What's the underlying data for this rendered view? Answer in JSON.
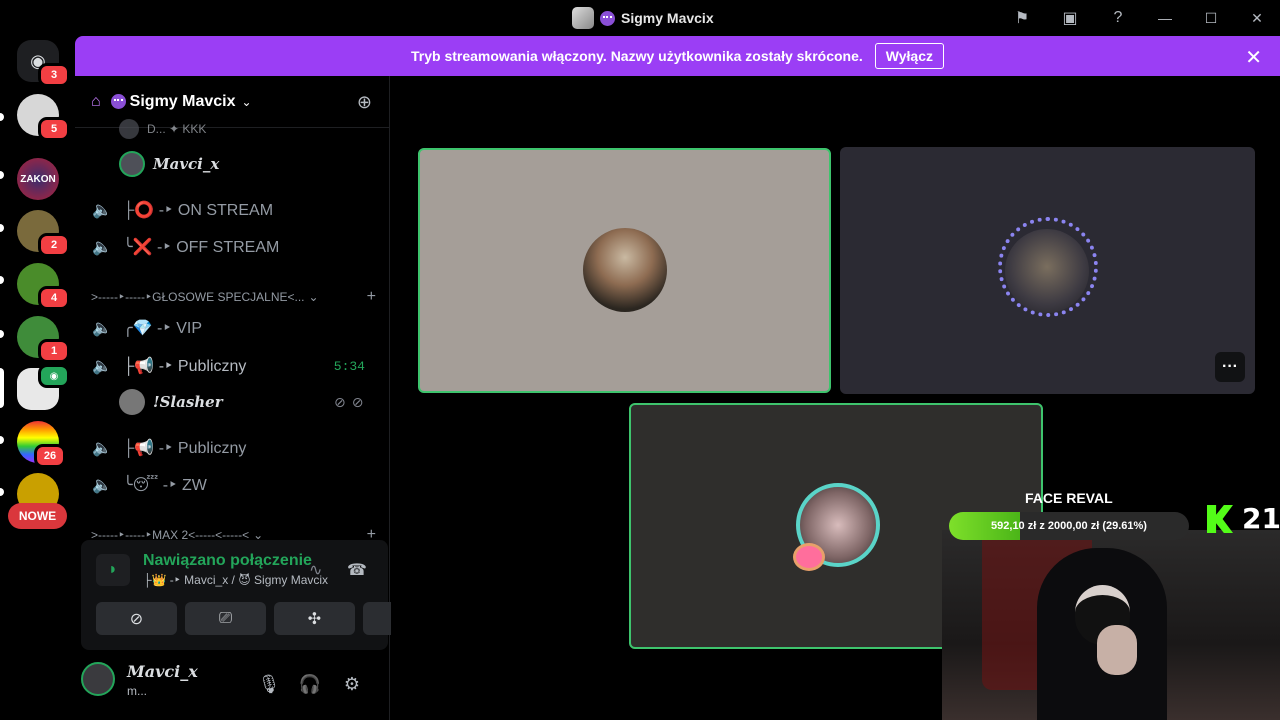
{
  "window": {
    "title": "Sigmy Mavcix",
    "controls": [
      "flag-icon",
      "inbox-icon",
      "help-icon",
      "minimize-icon",
      "maximize-icon",
      "close-icon"
    ]
  },
  "rail": {
    "home_badge": "3",
    "servers": [
      {
        "badge": "5"
      },
      {
        "label": "ZAKON"
      },
      {
        "badge": "2"
      },
      {
        "badge": "4"
      },
      {
        "badge": "1"
      },
      {
        "badge": ""
      },
      {
        "badge": "26"
      },
      {
        "badge": ""
      }
    ],
    "new_label": "NOWE"
  },
  "banner": {
    "text": "Tryb streamowania włączony. Nazwy użytkownika zostały skrócone.",
    "button": "Wyłącz"
  },
  "guild": {
    "name": "Sigmy Mavcix"
  },
  "channels": {
    "partial_top": "D... ✦ KKK",
    "member_top": "Mavci_x",
    "list1": [
      {
        "name": "├⭕ -‣ ON STREAM"
      },
      {
        "name": "╰❌ -‣ OFF STREAM"
      }
    ],
    "category1": ">-----‣-----‣GŁOSOWE SPECJALNE<...",
    "list2": [
      {
        "name": "╭💎 -‣ VIP"
      },
      {
        "name": "├📢 -‣ Publiczny",
        "time": "5:34"
      }
    ],
    "member_mid": "!Slasher",
    "list3": [
      {
        "name": "├📢 -‣ Publiczny"
      },
      {
        "name": "╰😴 -‣ ZW"
      }
    ],
    "category2": ">-----‣-----‣MAX 2<-----<-----<"
  },
  "voice": {
    "status": "Nawiązano połączenie",
    "sub": "├👑 -‣ Mavci_x / 😈 Sigmy Mavcix"
  },
  "user": {
    "name": "Mavci_x",
    "sub": "m..."
  },
  "overlay": {
    "goal_title": "FACE REVAL",
    "goal_text": "592,10 zł z 2000,00 zł (29.61%)",
    "goal_fraction": 0.2961,
    "viewer_count": "21"
  },
  "colors": {
    "banner": "#9b3ef5",
    "speaking": "#3ec46d",
    "connected": "#23a55a",
    "kick": "#53fc18",
    "badge": "#f23f43"
  }
}
